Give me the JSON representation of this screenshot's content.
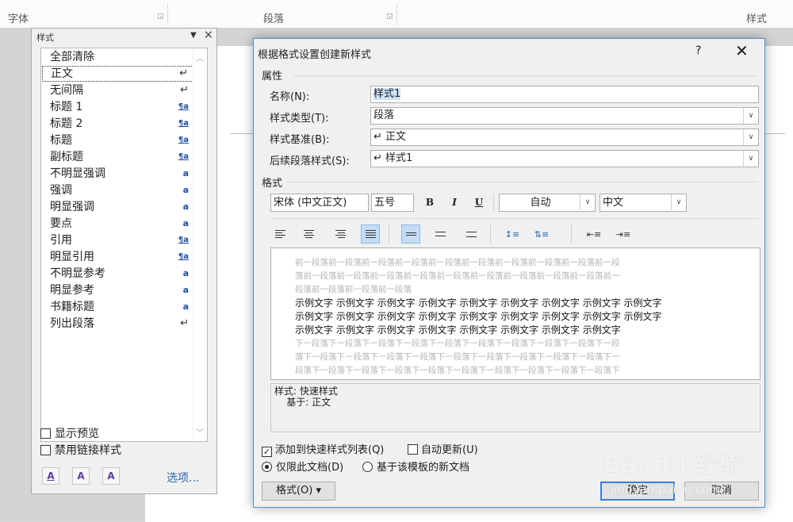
{
  "ribbon": {
    "groups": [
      {
        "label": "字体"
      },
      {
        "label": "段落"
      },
      {
        "label": "样式"
      }
    ]
  },
  "styles_pane": {
    "title": "样式",
    "dropdown_glyph": "▼",
    "close_glyph": "×",
    "items": [
      {
        "name": "全部清除",
        "mark": ""
      },
      {
        "name": "正文",
        "mark": "↵"
      },
      {
        "name": "无间隔",
        "mark": "↵"
      },
      {
        "name": "标题 1",
        "mark": "¶a"
      },
      {
        "name": "标题 2",
        "mark": "¶a"
      },
      {
        "name": "标题",
        "mark": "¶a"
      },
      {
        "name": "副标题",
        "mark": "¶a"
      },
      {
        "name": "不明显强调",
        "mark": "a"
      },
      {
        "name": "强调",
        "mark": "a"
      },
      {
        "name": "明显强调",
        "mark": "a"
      },
      {
        "name": "要点",
        "mark": "a"
      },
      {
        "name": "引用",
        "mark": "¶a"
      },
      {
        "name": "明显引用",
        "mark": "¶a"
      },
      {
        "name": "不明显参考",
        "mark": "a"
      },
      {
        "name": "明显参考",
        "mark": "a"
      },
      {
        "name": "书籍标题",
        "mark": "a"
      },
      {
        "name": "列出段落",
        "mark": "↵"
      }
    ],
    "selected_item": "正文",
    "show_preview_label": "显示预览",
    "disable_linked_label": "禁用链接样式",
    "buttons": [
      {
        "icon": "new-style-icon",
        "glyph": "A"
      },
      {
        "icon": "style-inspector-icon",
        "glyph": "A"
      },
      {
        "icon": "manage-styles-icon",
        "glyph": "A"
      }
    ],
    "options_label": "选项..."
  },
  "dialog": {
    "title": "根据格式设置创建新样式",
    "help": "?",
    "close": "✕",
    "properties_header": "属性",
    "name_label": "名称(N):",
    "name_value": "样式1",
    "type_label": "样式类型(T):",
    "type_value": "段落",
    "based_label": "样式基准(B):",
    "based_value": "↵ 正文",
    "next_label": "后续段落样式(S):",
    "next_value": "↵ 样式1",
    "format_header": "格式",
    "font_value": "宋体 (中文正文)",
    "size_value": "五号",
    "bold": "B",
    "italic": "I",
    "underline": "U",
    "color_value": "自动",
    "lang_value": "中文",
    "preview": {
      "before_lines": [
        "前一段落前一段落前一段落前一段落前一段落前一段落前一段落前一段落前一段落前一段",
        "落前一段落前一段落前一段落前一段落前一段落前一段落前一段落前一段落前一段落前一",
        "段落前一段落前一段落前一段落"
      ],
      "sample_lines": [
        "示例文字 示例文字 示例文字 示例文字 示例文字 示例文字 示例文字 示例文字 示例文字",
        "示例文字 示例文字 示例文字 示例文字 示例文字 示例文字 示例文字 示例文字 示例文字",
        "示例文字 示例文字 示例文字 示例文字 示例文字 示例文字 示例文字 示例文字"
      ],
      "after_lines": [
        "下一段落下一段落下一段落下一段落下一段落下一段落下一段落下一段落下一段落下一段",
        "落下一段落下一段落下一段落下一段落下一段落下一段落下一段落下一段落下一段落下一",
        "段落下一段落下一段落下一段落下一段落下一段落下一段落下一段落下一段落下一段落下"
      ]
    },
    "description": "样式: 快速样式\n    基于: 正文",
    "add_to_quick_label": "添加到快速样式列表(Q)",
    "add_to_quick_checked": true,
    "auto_update_label": "自动更新(U)",
    "auto_update_checked": false,
    "only_doc_label": "仅限此文档(D)",
    "new_docs_label": "基于该模板的新文档",
    "format_button": "格式(O) ▾",
    "ok_button": "确定",
    "cancel_button": "取消"
  },
  "watermark": {
    "brand": "Bai du 经验",
    "url": "jingyan.baidu.com"
  }
}
